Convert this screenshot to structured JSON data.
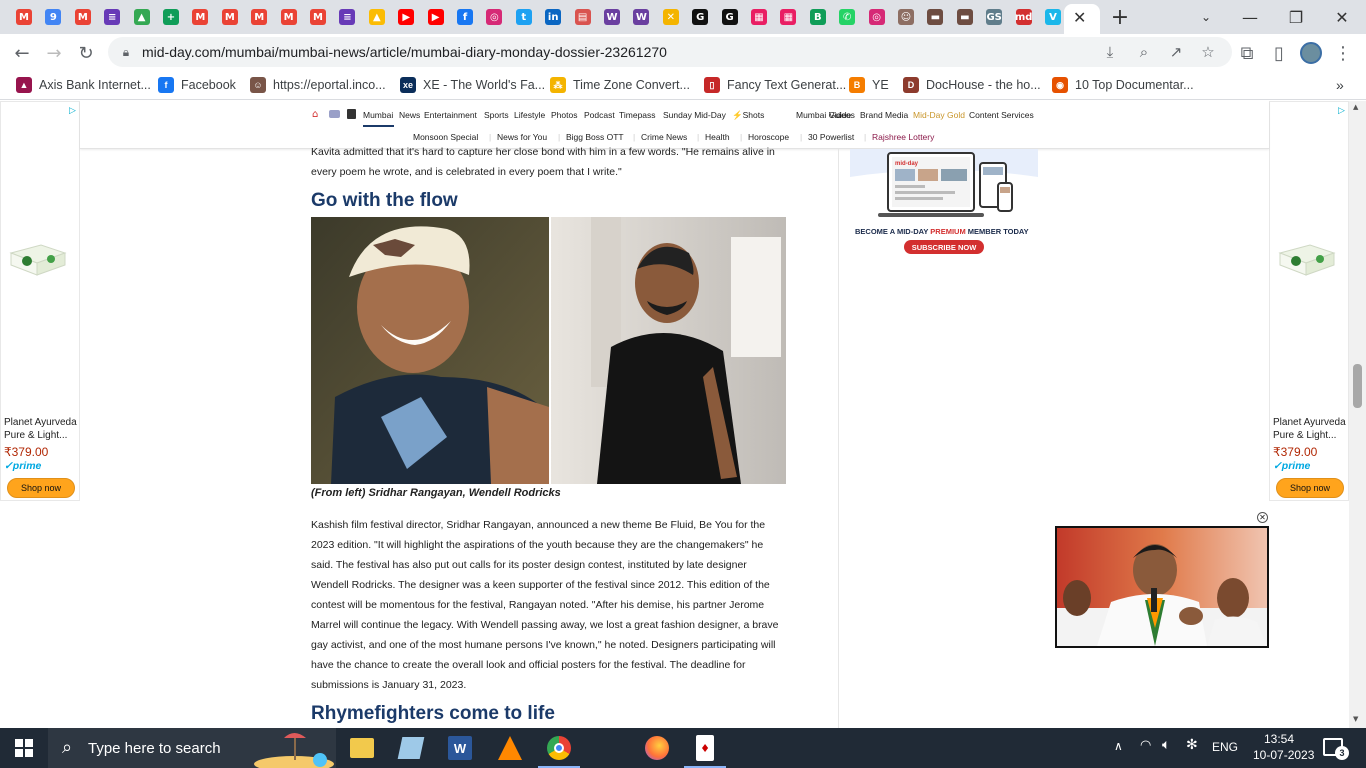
{
  "browser": {
    "tabs": [
      {
        "icon": "gmail",
        "color": "#ea4335",
        "glyph": "M"
      },
      {
        "icon": "calendar",
        "color": "#4285f4",
        "glyph": "9"
      },
      {
        "icon": "gmail",
        "color": "#ea4335",
        "glyph": "M"
      },
      {
        "icon": "forms",
        "color": "#673ab7",
        "glyph": "≡"
      },
      {
        "icon": "drive",
        "color": "#34a853",
        "glyph": "▲"
      },
      {
        "icon": "sheets",
        "color": "#0f9d58",
        "glyph": "+"
      },
      {
        "icon": "gmail",
        "color": "#ea4335",
        "glyph": "M"
      },
      {
        "icon": "gmail",
        "color": "#ea4335",
        "glyph": "M"
      },
      {
        "icon": "gmail",
        "color": "#ea4335",
        "glyph": "M"
      },
      {
        "icon": "gmail",
        "color": "#ea4335",
        "glyph": "M"
      },
      {
        "icon": "gmail",
        "color": "#ea4335",
        "glyph": "M"
      },
      {
        "icon": "forms",
        "color": "#673ab7",
        "glyph": "≡"
      },
      {
        "icon": "drive",
        "color": "#fbbc04",
        "glyph": "▲"
      },
      {
        "icon": "youtube",
        "color": "#ff0000",
        "glyph": "▶"
      },
      {
        "icon": "youtube",
        "color": "#ff0000",
        "glyph": "▶"
      },
      {
        "icon": "facebook",
        "color": "#1877f2",
        "glyph": "f"
      },
      {
        "icon": "instagram",
        "color": "#d62976",
        "glyph": "◎"
      },
      {
        "icon": "twitter",
        "color": "#1da1f2",
        "glyph": "t"
      },
      {
        "icon": "linkedin",
        "color": "#0a66c2",
        "glyph": "in"
      },
      {
        "icon": "book",
        "color": "#d9534f",
        "glyph": "▤"
      },
      {
        "icon": "w-app",
        "color": "#6a3fa0",
        "glyph": "W"
      },
      {
        "icon": "w-app",
        "color": "#6a3fa0",
        "glyph": "W"
      },
      {
        "icon": "x-app",
        "color": "#f4b400",
        "glyph": "✕"
      },
      {
        "icon": "g-app",
        "color": "#111111",
        "glyph": "G"
      },
      {
        "icon": "g-app",
        "color": "#111111",
        "glyph": "G"
      },
      {
        "icon": "grid-app",
        "color": "#e91e63",
        "glyph": "▦"
      },
      {
        "icon": "grid-app",
        "color": "#e91e63",
        "glyph": "▦"
      },
      {
        "icon": "b-app",
        "color": "#0f9d58",
        "glyph": "B"
      },
      {
        "icon": "whatsapp",
        "color": "#25d366",
        "glyph": "✆"
      },
      {
        "icon": "instagram",
        "color": "#d62976",
        "glyph": "◎"
      },
      {
        "icon": "people",
        "color": "#8d6e63",
        "glyph": "☺"
      },
      {
        "icon": "bar",
        "color": "#6d4c41",
        "glyph": "▬"
      },
      {
        "icon": "bar",
        "color": "#6d4c41",
        "glyph": "▬"
      },
      {
        "icon": "gs",
        "color": "#607d8b",
        "glyph": "GS"
      },
      {
        "icon": "mid-day",
        "color": "#d32f2f",
        "glyph": "md"
      },
      {
        "icon": "vimeo",
        "color": "#1ab7ea",
        "glyph": "V"
      }
    ],
    "url": "mid-day.com/mumbai/mumbai-news/article/mumbai-diary-monday-dossier-23261270",
    "bookmarks": [
      {
        "label": "Axis Bank Internet...",
        "icon": "axis-bank",
        "color": "#97144d",
        "glyph": "▲"
      },
      {
        "label": "Facebook",
        "icon": "facebook",
        "color": "#1877f2",
        "glyph": "f"
      },
      {
        "label": "https://eportal.inco...",
        "icon": "eportal",
        "color": "#795548",
        "glyph": "☺"
      },
      {
        "label": "XE - The World's Fa...",
        "icon": "xe",
        "color": "#0b2e5a",
        "glyph": "xe"
      },
      {
        "label": "Time Zone Convert...",
        "icon": "timezone",
        "color": "#f4b400",
        "glyph": "⁂"
      },
      {
        "label": "Fancy Text Generat...",
        "icon": "fancy-text",
        "color": "#c62828",
        "glyph": "▯"
      },
      {
        "label": "YE",
        "icon": "blogger",
        "color": "#f57d00",
        "glyph": "B"
      },
      {
        "label": "DocHouse - the ho...",
        "icon": "dochouse",
        "color": "#8d3b2d",
        "glyph": "D"
      },
      {
        "label": "10 Top Documentar...",
        "icon": "documentary",
        "color": "#e65100",
        "glyph": "◉"
      }
    ]
  },
  "site_nav": {
    "main": [
      "Mumbai",
      "News",
      "Entertainment",
      "Sports",
      "Lifestyle",
      "Photos",
      "Podcast",
      "Timepass",
      "Sunday Mid-Day",
      "Shots",
      "Mumbai Guide",
      "Videos",
      "Brand Media",
      "Mid-Day Gold",
      "Content Services"
    ],
    "sub": [
      "Monsoon Special",
      "News for You",
      "Bigg Boss OTT",
      "Crime News",
      "Health",
      "Horoscope",
      "30 Powerlist",
      "Rajshree Lottery"
    ],
    "gold_color": "#c9962b",
    "lottery_color": "#8b1a4a"
  },
  "ad": {
    "title_line1": "Planet Ayurveda",
    "title_line2": "Pure & Light...",
    "price": "₹379.00",
    "prime": "✓prime",
    "button": "Shop now"
  },
  "premium_ad": {
    "brand": "mid-day",
    "tagline_prefix": "BECOME A MID-DAY ",
    "tagline_premium": "PREMIUM",
    "tagline_suffix": " MEMBER TODAY",
    "button": "SUBSCRIBE NOW"
  },
  "article": {
    "intro": [
      "Kavita admitted that it's hard to capture her close bond with him in a few words. \"He remains alive in",
      "every poem he wrote, and is celebrated in every poem that I write.\""
    ],
    "heading1": "Go with the flow",
    "caption": "(From left) Sridhar Rangayan, Wendell Rodricks",
    "body": [
      "Kashish film festival director, Sridhar Rangayan, announced a new theme Be Fluid, Be You for the",
      "2023 edition. \"It will highlight the aspirations of the youth because they are the changemakers\" he",
      "said. The festival has also put out calls for its poster design contest, instituted by late designer",
      "Wendell Rodricks. The designer was a keen supporter of the festival since 2012. This edition of the",
      "contest will be momentous for the festival, Rangayan noted. \"After his demise, his partner Jerome",
      "Marrel will continue the legacy. With Wendell passing away, we lost a great fashion designer, a brave",
      "gay activist, and one of the most humane persons I've known,\" he noted. Designers participating will",
      "have the chance to create the overall look and official posters for the festival. The deadline for",
      "submissions is January 31, 2023."
    ],
    "heading2": "Rhymefighters come to life"
  },
  "taskbar": {
    "search_placeholder": "Type here to search",
    "lang": "ENG",
    "time": "13:54",
    "date": "10-07-2023",
    "notifications": "3"
  }
}
